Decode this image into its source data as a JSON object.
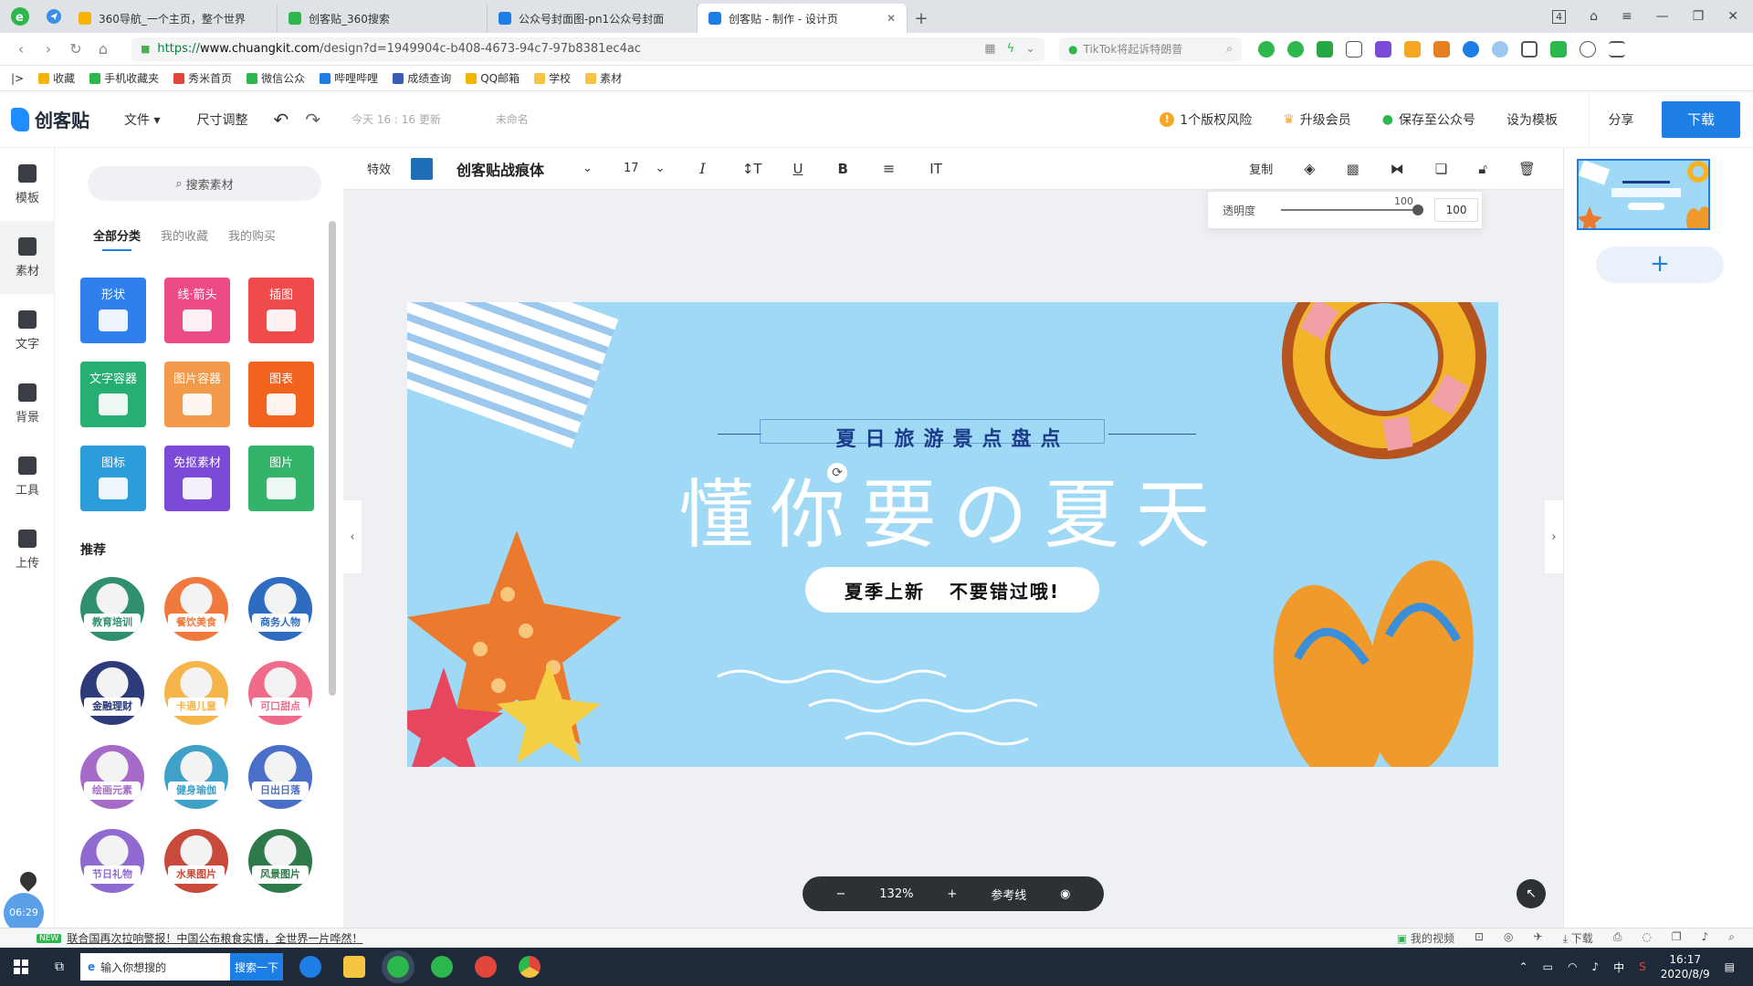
{
  "browser": {
    "tabs": [
      {
        "title": "360导航_一个主页，整个世界",
        "color": "#f5b400",
        "active": false
      },
      {
        "title": "创客贴_360搜索",
        "color": "#2db84d",
        "active": false
      },
      {
        "title": "公众号封面图-pn1公众号封面",
        "color": "#1d7fe6",
        "active": false
      },
      {
        "title": "创客贴 - 制作 - 设计页",
        "color": "#1d7fe6",
        "active": true
      }
    ],
    "new_tab": "+",
    "tab_counter": "4",
    "url_secure": "https://",
    "url_host": "www.chuangkit.com",
    "url_path": "/design?d=1949904c-b408-4673-94c7-97b8381ec4ac",
    "search_placeholder": "TikTok将起诉特朗普",
    "bookmarks": [
      {
        "label": "收藏",
        "color": "#f5b400"
      },
      {
        "label": "手机收藏夹",
        "color": "#2db84d"
      },
      {
        "label": "秀米首页",
        "color": "#e0463b"
      },
      {
        "label": "微信公众",
        "color": "#2db84d"
      },
      {
        "label": "哔哩哔哩",
        "color": "#1d7fe6"
      },
      {
        "label": "成绩查询",
        "color": "#3b5bb8"
      },
      {
        "label": "QQ邮箱",
        "color": "#f5b400"
      },
      {
        "label": "学校",
        "color": "#f5c542"
      },
      {
        "label": "素材",
        "color": "#f5c542"
      }
    ]
  },
  "app": {
    "logo_text": "创客贴",
    "menu_file": "文件 ▾",
    "menu_resize": "尺寸调整",
    "undo_icon": "↶",
    "redo_icon": "↷",
    "save_time": "今天 16 : 16 更新",
    "doc_name": "未命名",
    "copyright_risk": "1个版权风险",
    "upgrade": "升级会员",
    "save_wechat": "保存至公众号",
    "set_template": "设为模板",
    "share": "分享",
    "download": "下载"
  },
  "rail": [
    {
      "label": "模板",
      "icon": "template-icon"
    },
    {
      "label": "素材",
      "icon": "material-icon"
    },
    {
      "label": "文字",
      "icon": "text-icon"
    },
    {
      "label": "背景",
      "icon": "background-icon"
    },
    {
      "label": "工具",
      "icon": "tool-icon"
    },
    {
      "label": "上传",
      "icon": "upload-icon"
    }
  ],
  "panel": {
    "search": "搜索素材",
    "tabs": [
      "全部分类",
      "我的收藏",
      "我的购买"
    ],
    "categories": [
      {
        "label": "形状",
        "color": "#2f80ed"
      },
      {
        "label": "线·箭头",
        "color": "#ec4b86"
      },
      {
        "label": "插图",
        "color": "#ef4b4b"
      },
      {
        "label": "文字容器",
        "color": "#27ae73"
      },
      {
        "label": "图片容器",
        "color": "#f2994a"
      },
      {
        "label": "图表",
        "color": "#f2641e"
      },
      {
        "label": "图标",
        "color": "#2d9cdb"
      },
      {
        "label": "免抠素材",
        "color": "#7b4bd8"
      },
      {
        "label": "图片",
        "color": "#34b36a"
      }
    ],
    "recommend_title": "推荐",
    "recommendations": [
      {
        "label": "教育培训",
        "color": "#2f8f6e"
      },
      {
        "label": "餐饮美食",
        "color": "#f07a3e"
      },
      {
        "label": "商务人物",
        "color": "#2d6cc0"
      },
      {
        "label": "金融理财",
        "color": "#2d3b7a"
      },
      {
        "label": "卡通儿童",
        "color": "#f5b54a"
      },
      {
        "label": "可口甜点",
        "color": "#f06a8a"
      },
      {
        "label": "绘画元素",
        "color": "#a66bc8"
      },
      {
        "label": "健身瑜伽",
        "color": "#3fa0c8"
      },
      {
        "label": "日出日落",
        "color": "#4a6fc8"
      },
      {
        "label": "节日礼物",
        "color": "#8f6ad0"
      },
      {
        "label": "水果图片",
        "color": "#c84a3a"
      },
      {
        "label": "风景图片",
        "color": "#2f7a4a"
      }
    ]
  },
  "toolbar": {
    "effects": "特效",
    "font_color": "#1d6fb8",
    "font": "创客贴战痕体",
    "font_size": "17",
    "copy": "复制"
  },
  "opacity": {
    "label": "透明度",
    "max_label": "100",
    "value": "100"
  },
  "canvas": {
    "headline": "夏日旅游景点盘点",
    "title": "懂你要の夏天",
    "subtitle": "夏季上新   不要错过哦!",
    "colors": {
      "background": "#9fd9f6",
      "lifebuoy": "#f2b52a",
      "starfish": "#ec7a2e",
      "flipflop": "#f09a2c"
    }
  },
  "zoom": {
    "minus": "−",
    "level": "132%",
    "plus": "+",
    "guides": "参考线"
  },
  "pages": {
    "add": "+"
  },
  "statusbar": {
    "badge": "NEW",
    "news": "联合国再次拉响警报！中国公布粮食实情，全世界一片哗然！",
    "my_video": "我的视频",
    "download": "下载"
  },
  "taskbar": {
    "search_placeholder": "输入你想搜的",
    "search_btn": "搜索一下",
    "ime": "中",
    "time": "16:17",
    "date": "2020/8/9"
  },
  "misc": {
    "timer": "06:29"
  }
}
